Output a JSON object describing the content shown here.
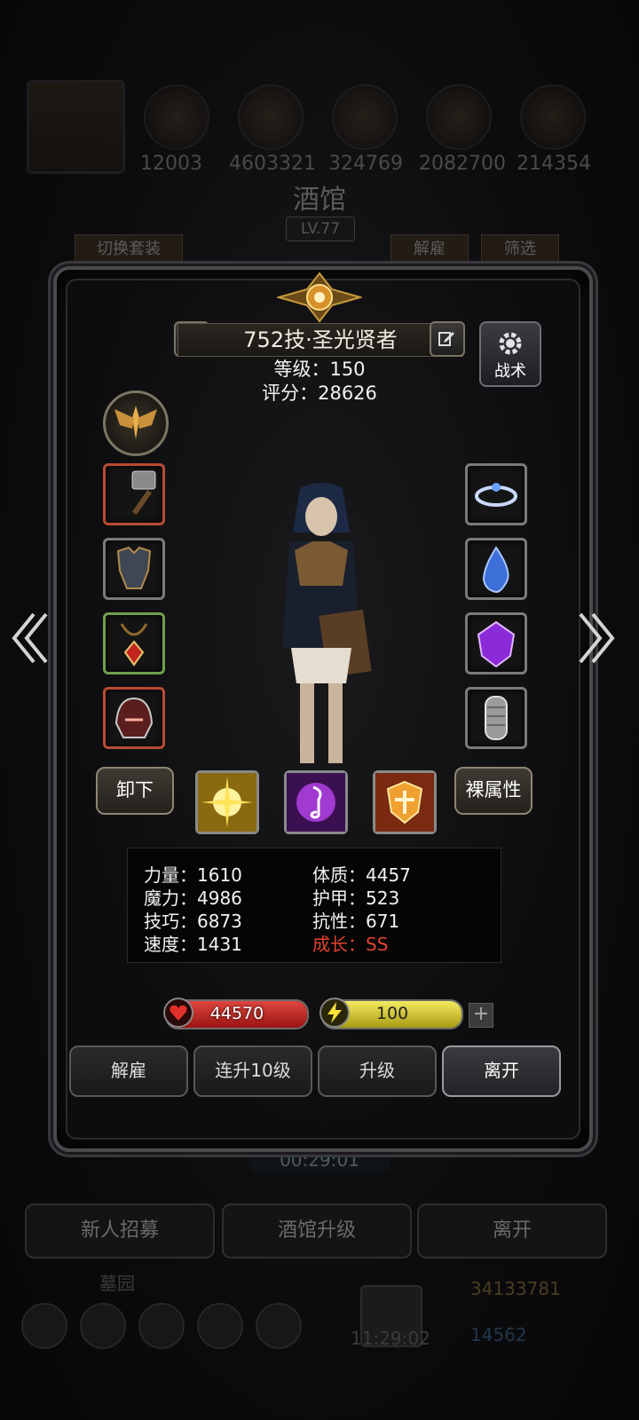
{
  "background": {
    "resources": [
      "12003",
      "4603321",
      "324769",
      "2082700",
      "214354"
    ],
    "title": "酒馆",
    "level": "LV.77",
    "switch_outfit_label": "切换套装",
    "dismiss_label": "解雇",
    "filter_label": "筛选",
    "timer": "00:29:01",
    "bottom_buttons": [
      "新人招募",
      "酒馆升级",
      "离开"
    ],
    "yard_label": "墓园",
    "gold": "34133781",
    "gems": "14562",
    "clock": "11:29:02"
  },
  "hero": {
    "name": "752技·圣光贤者",
    "level_line": "等级：150",
    "score_line": "评分：28626",
    "tactic_label": "战术"
  },
  "equipment": {
    "left": [
      "hammer-icon",
      "armor-icon",
      "amulet-icon",
      "helmet-icon"
    ],
    "right": [
      "crown-icon",
      "water-drop-icon",
      "purple-gem-icon",
      "chain-mail-icon"
    ]
  },
  "actions": {
    "unequip_label": "卸下",
    "base_attr_label": "裸属性"
  },
  "skills": [
    "light-burst-icon",
    "music-magic-icon",
    "holy-shield-icon"
  ],
  "attributes": {
    "strength": "力量：1610",
    "magic": "魔力：4986",
    "skill": "技巧：6873",
    "speed": "速度：1431",
    "constitution": "体质：4457",
    "armor": "护甲：523",
    "resistance": "抗性：671",
    "growth": "成长：SS"
  },
  "bars": {
    "hp_value": "44570",
    "energy_value": "100"
  },
  "bottom_actions": [
    "解雇",
    "连升10级",
    "升级",
    "离开"
  ],
  "colors": {
    "hp": "#c8221f",
    "energy": "#d8cf2a",
    "growth": "#e0432f"
  }
}
